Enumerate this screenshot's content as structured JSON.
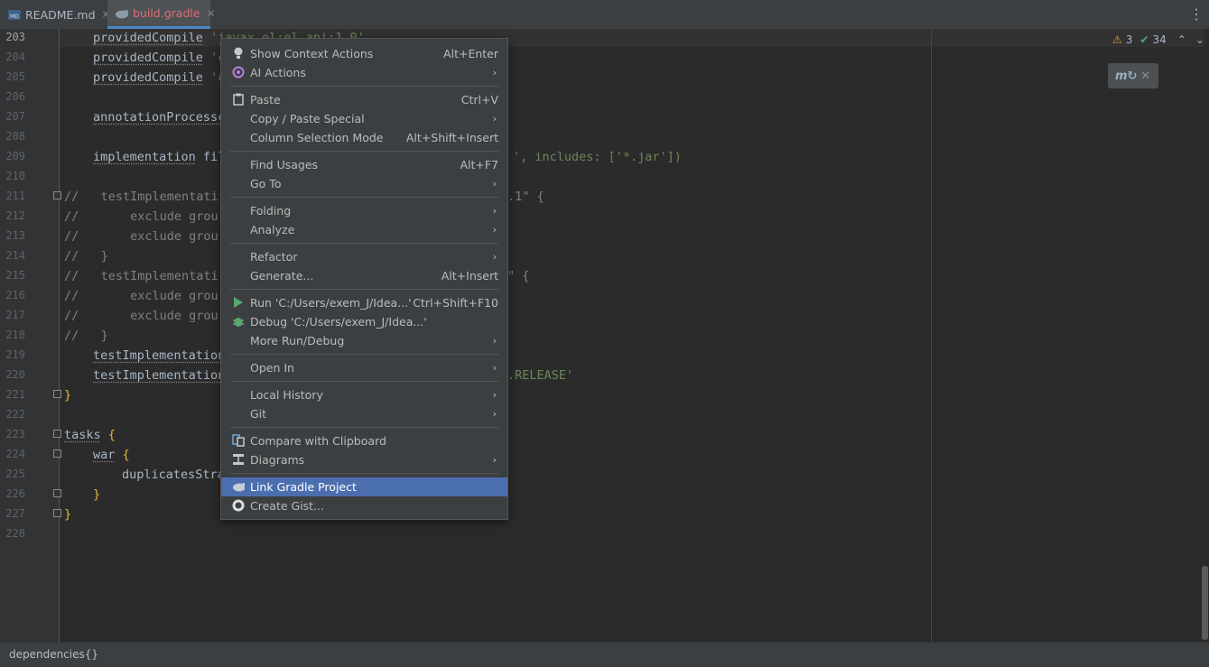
{
  "tabs": [
    {
      "label": "README.md",
      "icon": "markdown-file-icon",
      "active": false
    },
    {
      "label": "build.gradle",
      "icon": "gradle-elephant-icon",
      "active": true
    }
  ],
  "gutter": {
    "line_numbers": [
      "203",
      "204",
      "205",
      "206",
      "207",
      "208",
      "209",
      "210",
      "211",
      "212",
      "213",
      "214",
      "215",
      "216",
      "217",
      "218",
      "219",
      "220",
      "221",
      "222",
      "223",
      "224",
      "225",
      "226",
      "227",
      "228"
    ],
    "current_line": "203"
  },
  "code": {
    "l203_a": "providedCompile",
    "l203_b": " 'javax.el:el-api:1.0'",
    "l204_a": "providedCompile",
    "l204_b": " 'c",
    "l205_a": "providedCompile",
    "l205_b": " 'c",
    "l207_a": "annotationProcessc",
    "l209_a": "implementation",
    "l209_b": " fil",
    "l209_c": "', includes: ['*.jar'])",
    "l211_a": "//   testImplementati",
    "l211_b": ".1\" {",
    "l212_a": "//       exclude grou",
    "l213_a": "//       exclude grou",
    "l214_a": "//   }",
    "l215_a": "//   testImplementati",
    "l215_b": "\" {",
    "l216_a": "//       exclude grou",
    "l217_a": "//       exclude grou",
    "l218_a": "//   }",
    "l219_a": "testImplementation",
    "l220_a": "testImplementation",
    "l220_b": ".RELEASE'",
    "l221_a": "}",
    "l223_a": "tasks",
    "l223_b": " {",
    "l224_a": "war",
    "l224_b": " {",
    "l225_a": "duplicatesStra",
    "l226_a": "}",
    "l227_a": "}"
  },
  "inspections": {
    "warnings": "3",
    "ok": "34"
  },
  "status": {
    "breadcrumb": "dependencies{}"
  },
  "context_menu": {
    "items": [
      {
        "label": "Show Context Actions",
        "shortcut": "Alt+Enter",
        "icon": "bulb-icon"
      },
      {
        "label": "AI Actions",
        "submenu": true,
        "icon": "ai-spiral-icon"
      },
      {
        "label": "Paste",
        "shortcut": "Ctrl+V",
        "icon": "clipboard-icon"
      },
      {
        "label": "Copy / Paste Special",
        "submenu": true
      },
      {
        "label": "Column Selection Mode",
        "shortcut": "Alt+Shift+Insert"
      },
      {
        "label": "Find Usages",
        "shortcut": "Alt+F7"
      },
      {
        "label": "Go To",
        "submenu": true
      },
      {
        "label": "Folding",
        "submenu": true
      },
      {
        "label": "Analyze",
        "submenu": true
      },
      {
        "label": "Refactor",
        "submenu": true
      },
      {
        "label": "Generate...",
        "shortcut": "Alt+Insert"
      },
      {
        "label": "Run 'C:/Users/exem_J/Idea...'",
        "shortcut": "Ctrl+Shift+F10",
        "icon": "run-icon"
      },
      {
        "label": "Debug 'C:/Users/exem_J/Idea...'",
        "icon": "debug-bug-icon"
      },
      {
        "label": "More Run/Debug",
        "submenu": true
      },
      {
        "label": "Open In",
        "submenu": true
      },
      {
        "label": "Local History",
        "submenu": true
      },
      {
        "label": "Git",
        "submenu": true
      },
      {
        "label": "Compare with Clipboard",
        "icon": "compare-icon"
      },
      {
        "label": "Diagrams",
        "submenu": true,
        "icon": "diagram-icon"
      },
      {
        "label": "Link Gradle Project",
        "icon": "gradle-elephant-icon",
        "selected": true
      },
      {
        "label": "Create Gist...",
        "icon": "github-icon"
      }
    ]
  },
  "colors": {
    "selection": "#4b6eaf",
    "string": "#6a8759",
    "keyword": "#cc7832",
    "comment": "#808080"
  }
}
